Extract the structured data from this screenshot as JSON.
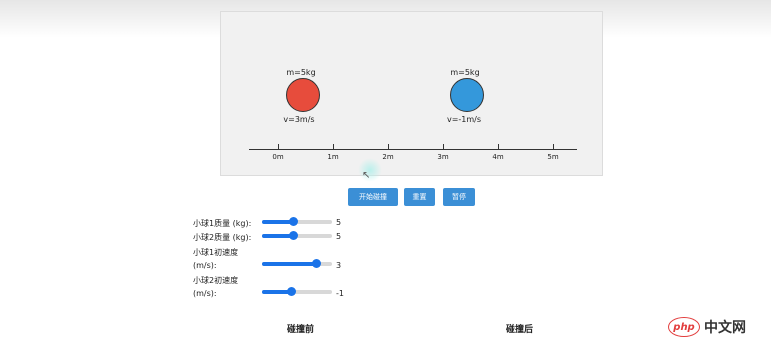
{
  "stage": {
    "ball1": {
      "mass_label": "m=5kg",
      "velocity_label": "v=3m/s",
      "color": "#e74c3c"
    },
    "ball2": {
      "mass_label": "m=5kg",
      "velocity_label": "v=-1m/s",
      "color": "#3498db"
    },
    "axis_ticks": [
      "0m",
      "1m",
      "2m",
      "3m",
      "4m",
      "5m"
    ]
  },
  "buttons": {
    "start_label": "开始碰撞",
    "reset_label": "重置",
    "pause_label": "暂停",
    "accent": "#3b8fd6"
  },
  "controls": [
    {
      "label": "小球1质量 (kg):",
      "value": "5",
      "fraction": 0.45
    },
    {
      "label": "小球2质量 (kg):",
      "value": "5",
      "fraction": 0.45
    },
    {
      "label": "小球1初速度",
      "label2": "(m/s):",
      "value": "3",
      "fraction": 0.78
    },
    {
      "label": "小球2初速度",
      "label2": "(m/s):",
      "value": "-1",
      "fraction": 0.42
    }
  ],
  "sections": {
    "before": "碰撞前",
    "after": "碰撞后"
  },
  "watermark": {
    "logo": "php",
    "text": "中文网"
  }
}
